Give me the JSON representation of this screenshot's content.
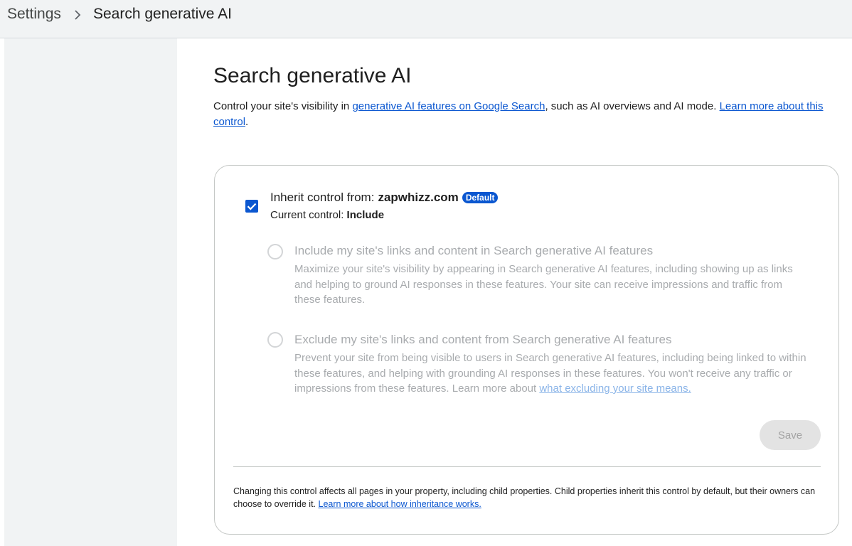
{
  "breadcrumb": {
    "root": "Settings",
    "current": "Search generative AI"
  },
  "page": {
    "title": "Search generative AI",
    "intro_prefix": "Control your site's visibility in ",
    "intro_link": "generative AI features on Google Search",
    "intro_middle": ", such as AI overviews and AI mode. ",
    "intro_learn_link": "Learn more about this control",
    "intro_suffix": "."
  },
  "inherit": {
    "checked": true,
    "label": "Inherit control from:",
    "domain": "zapwhizz.com",
    "badge": "Default",
    "current_label": "Current control:",
    "current_value": "Include"
  },
  "options": [
    {
      "title": "Include my site's links and content in Search generative AI features",
      "description": "Maximize your site's visibility by appearing in Search generative AI features, including showing up as links and helping to ground AI responses in these features. Your site can receive impressions and traffic from these features."
    },
    {
      "title": "Exclude my site's links and content from Search generative AI features",
      "description": "Prevent your site from being visible to users in Search generative AI features, including being linked to within these features, and helping with grounding AI responses in these features. You won't receive any traffic or impressions from these features. Learn more about ",
      "link": "what excluding your site means."
    }
  ],
  "save_label": "Save",
  "footer": {
    "text": "Changing this control affects all pages in your property, including child properties. Child properties inherit this control by default, but their owners can choose to override it. ",
    "link": "Learn more about how inheritance works."
  },
  "colors": {
    "accent": "#0b57d0",
    "disabled_text": "#a8abae",
    "topbar_bg": "#f1f3f4"
  }
}
